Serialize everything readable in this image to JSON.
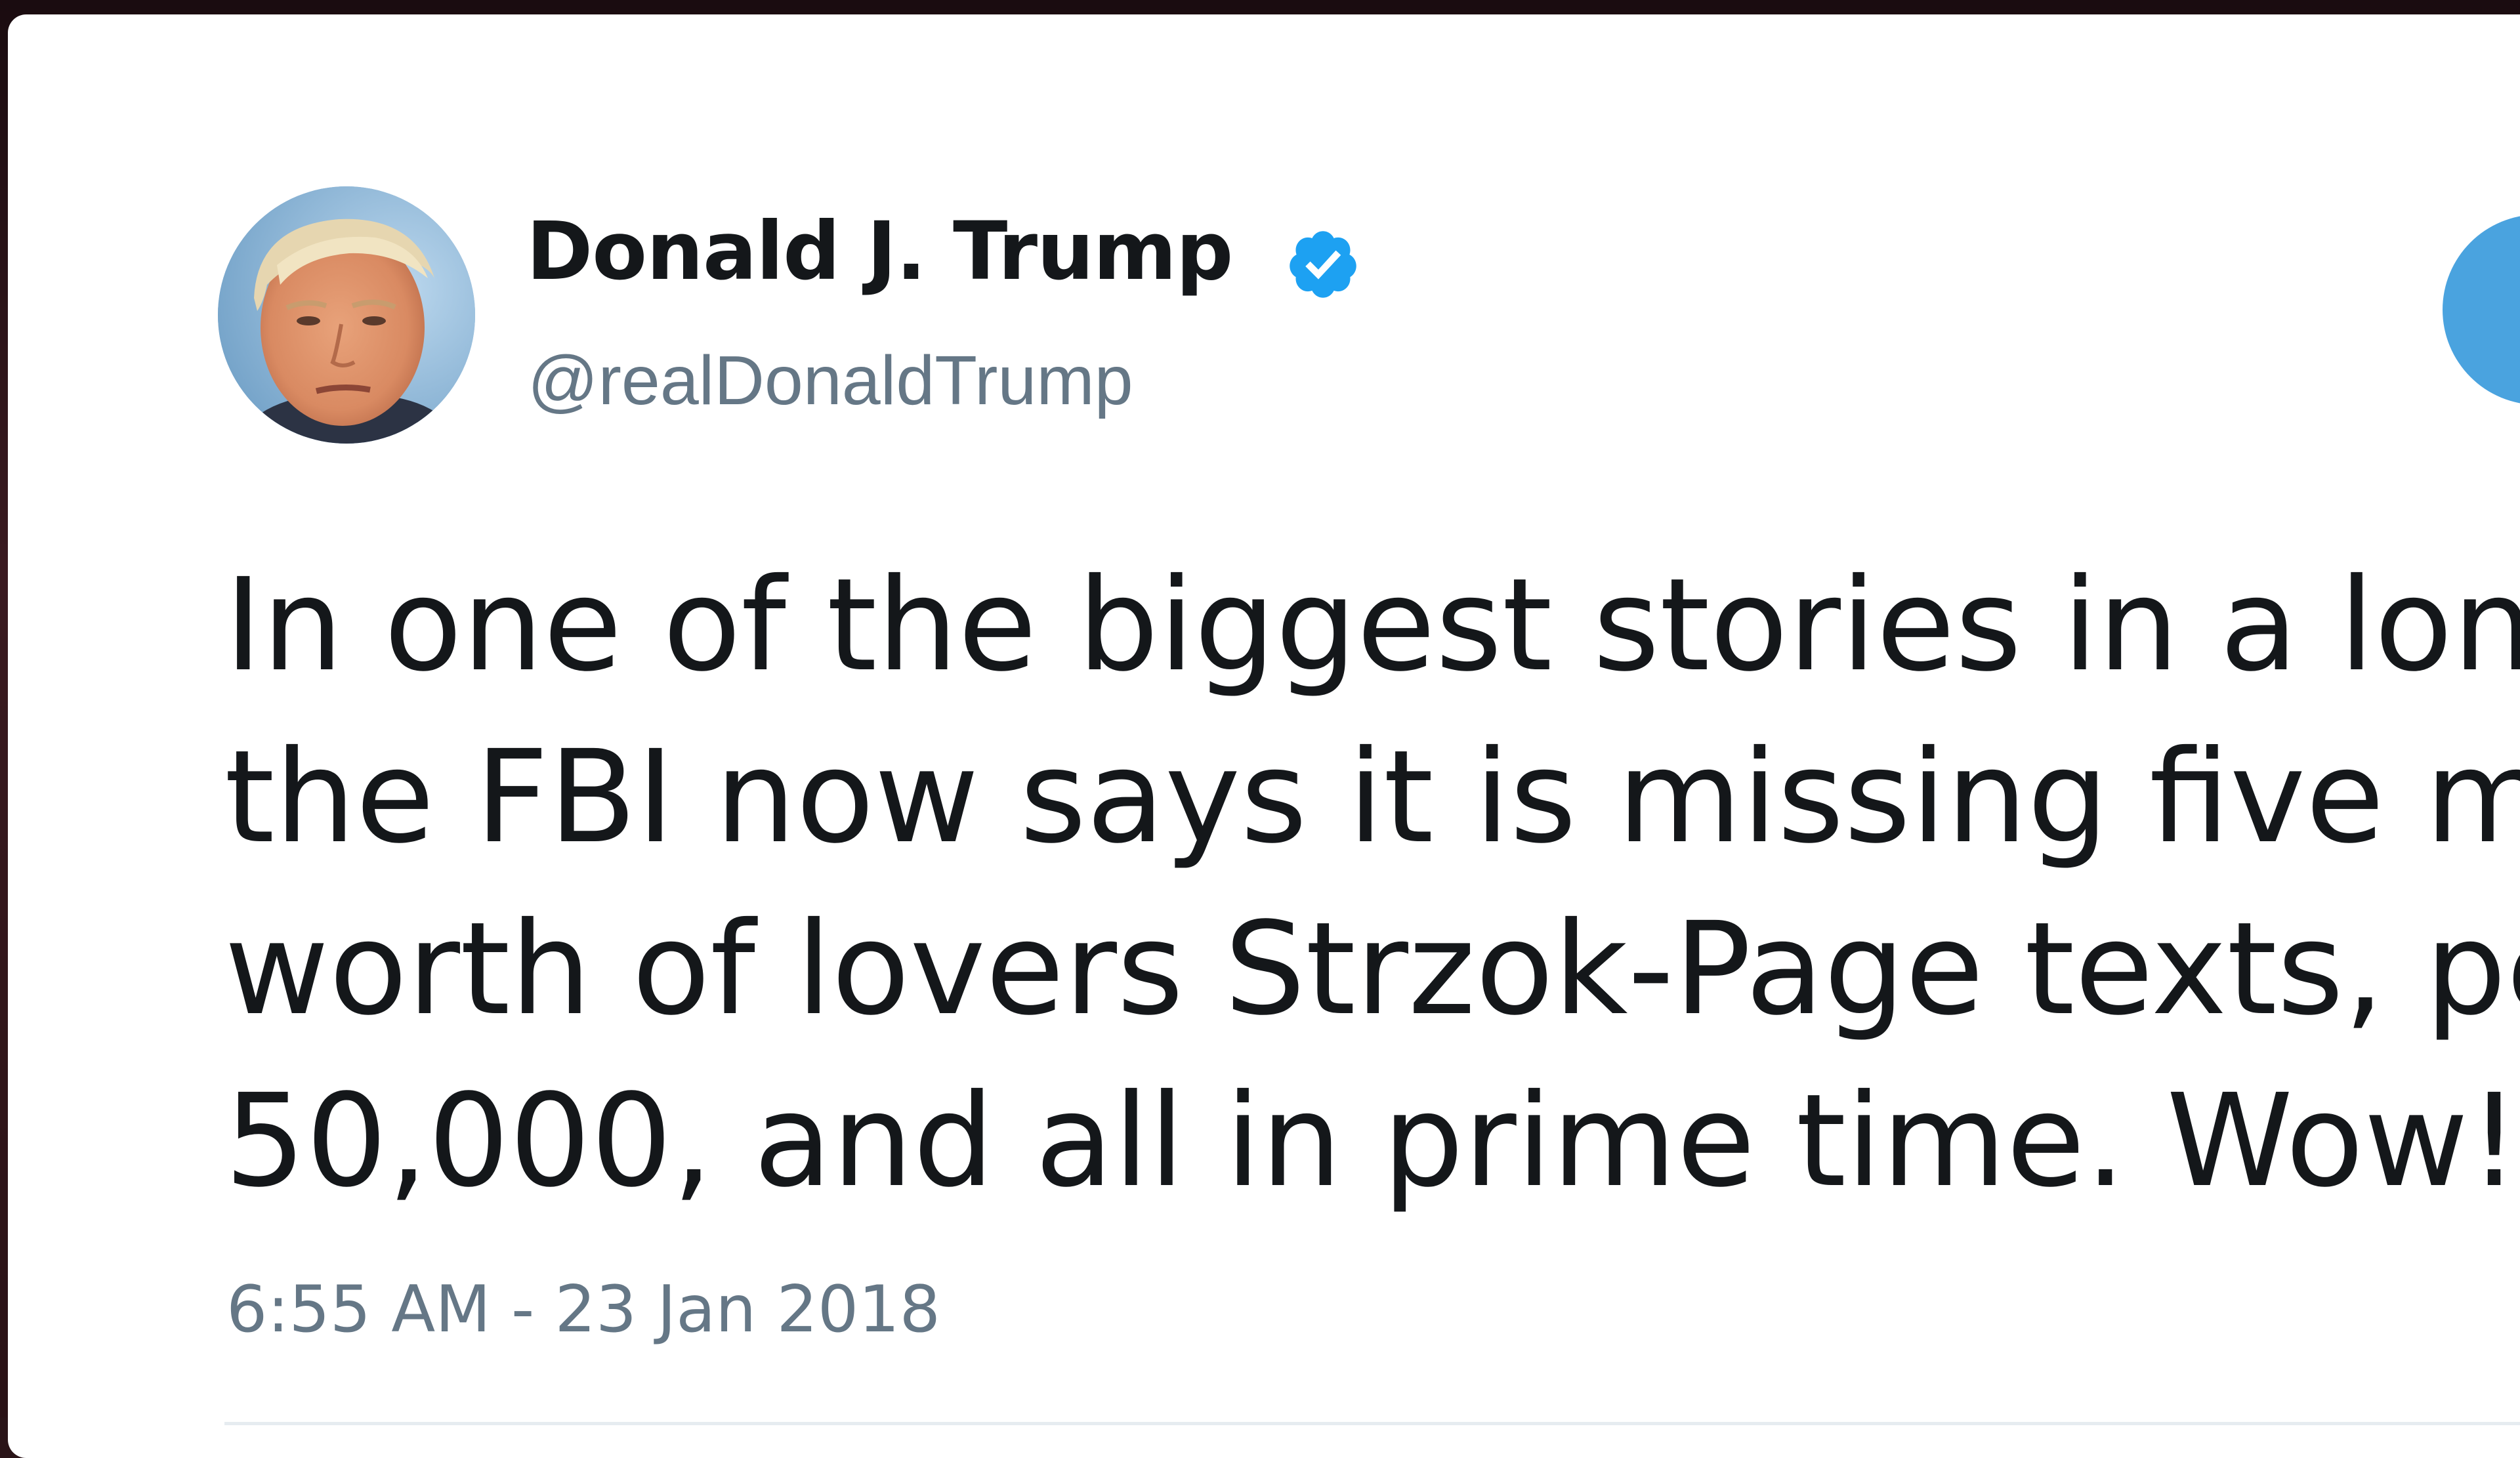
{
  "tweet": {
    "author": {
      "display_name": "Donald J. Trump",
      "handle": "@realDonaldTrump",
      "verified": true,
      "verified_icon": "verified-badge-icon",
      "avatar": "profile-photo"
    },
    "text_lines": [
      "In one of the biggest stories in a lon",
      "the FBI now says it is missing five mo",
      "worth of lovers Strzok-Page texts, pe",
      "50,000, and all in prime time. Wow!"
    ],
    "timestamp": "6:55 AM - 23 Jan 2018"
  },
  "colors": {
    "card_background": "#ffffff",
    "primary_text": "#14171a",
    "secondary_text": "#657786",
    "verified_blue": "#1da1f2",
    "follow_button": "#4aa3df",
    "divider": "#e6ecf0"
  }
}
